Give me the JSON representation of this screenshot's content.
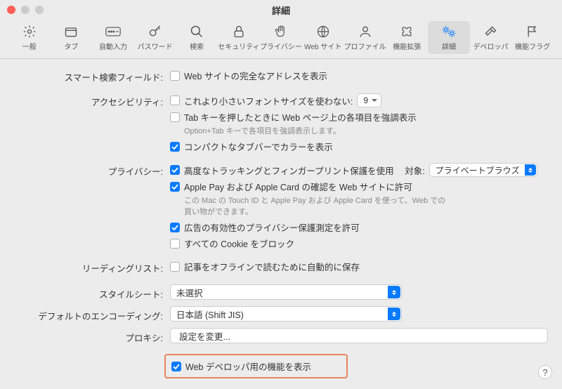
{
  "window": {
    "title": "詳細"
  },
  "toolbar": [
    {
      "id": "general",
      "label": "一般",
      "icon": "gear"
    },
    {
      "id": "tabs",
      "label": "タブ",
      "icon": "tab"
    },
    {
      "id": "autofill",
      "label": "自動入力",
      "icon": "autofill"
    },
    {
      "id": "passwords",
      "label": "パスワード",
      "icon": "key"
    },
    {
      "id": "search",
      "label": "検索",
      "icon": "search"
    },
    {
      "id": "security",
      "label": "セキュリティ",
      "icon": "lock"
    },
    {
      "id": "privacy",
      "label": "プライバシー",
      "icon": "hand"
    },
    {
      "id": "websites",
      "label": "Web サイト",
      "icon": "globe"
    },
    {
      "id": "profiles",
      "label": "プロファイル",
      "icon": "person"
    },
    {
      "id": "extensions",
      "label": "機能拡張",
      "icon": "puzzle"
    },
    {
      "id": "advanced",
      "label": "詳細",
      "icon": "gears",
      "selected": true
    },
    {
      "id": "developer",
      "label": "デベロッパ",
      "icon": "hammer"
    },
    {
      "id": "flags",
      "label": "機能フラグ",
      "icon": "flag"
    }
  ],
  "sections": {
    "smartSearch": {
      "label": "スマート検索フィールド:",
      "item1": {
        "text": "Web サイトの完全なアドレスを表示",
        "checked": false
      }
    },
    "accessibility": {
      "label": "アクセシビリティ:",
      "item1": {
        "text": "これより小さいフォントサイズを使わない:",
        "checked": false,
        "value": "9"
      },
      "item2": {
        "text": "Tab キーを押したときに Web ページ上の各項目を強調表示",
        "checked": false
      },
      "hint2": "Option+Tab キーで各項目を強調表示します。",
      "item3": {
        "text": "コンパクトなタブバーでカラーを表示",
        "checked": true
      }
    },
    "privacy": {
      "label": "プライバシー:",
      "item1": {
        "text": "高度なトラッキングとフィンガープリント保護を使用",
        "checked": true,
        "targetLabel": "対象:",
        "targetValue": "プライベートブラウズ"
      },
      "item2": {
        "text": "Apple Pay および Apple Card の確認を Web サイトに許可",
        "checked": true
      },
      "hint2": "この Mac の Touch ID と Apple Pay および Apple Card を使って、Web での買い物ができます。",
      "item3": {
        "text": "広告の有効性のプライバシー保護測定を許可",
        "checked": true
      },
      "item4": {
        "text": "すべての Cookie をブロック",
        "checked": false
      }
    },
    "readingList": {
      "label": "リーディングリスト:",
      "item1": {
        "text": "記事をオフラインで読むために自動的に保存",
        "checked": false
      }
    },
    "stylesheet": {
      "label": "スタイルシート:",
      "value": "未選択"
    },
    "encoding": {
      "label": "デフォルトのエンコーディング:",
      "value": "日本語 (Shift JIS)"
    },
    "proxy": {
      "label": "プロキシ:",
      "button": "設定を変更..."
    },
    "developer": {
      "text": "Web デベロッパ用の機能を表示",
      "checked": true
    }
  },
  "help": "?"
}
